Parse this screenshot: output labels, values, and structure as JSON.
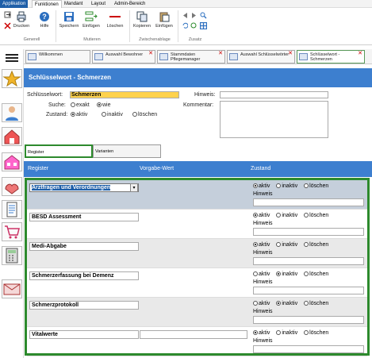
{
  "menubar": {
    "tabs": [
      "Applikation",
      "Funktionen",
      "Mandant",
      "Layout",
      "Admin-Bereich"
    ]
  },
  "ribbon": {
    "buttons": {
      "print": "Drucken",
      "help": "Hilfe",
      "save": "Speichern",
      "insert": "Einfügen",
      "delete": "Löschen",
      "copy": "Kopieren",
      "paste": "Einfügen"
    },
    "groups": {
      "general": "Generell",
      "mutate": "Mutieren",
      "clipboard": "Zwischenablage",
      "extra": "Zusatz"
    }
  },
  "doc_tabs": [
    {
      "label": "Willkommen"
    },
    {
      "label": "Auswahl Bewohner"
    },
    {
      "label": "Stammdaten Pflegemanager"
    },
    {
      "label": "Auswahl Schlüsselwörter"
    },
    {
      "label": "Schlüsselwort - Schmerzen"
    }
  ],
  "header": {
    "title": "Schlüsselwort - Schmerzen"
  },
  "form": {
    "keyword_label": "Schlüsselwort:",
    "keyword_value": "Schmerzen",
    "hint_label": "Hinweis:",
    "search_label": "Suche:",
    "search_opts": [
      "exakt",
      "wie"
    ],
    "comment_label": "Kommentar:",
    "state_label": "Zustand:",
    "state_opts": [
      "aktiv",
      "inaktiv",
      "löschen"
    ]
  },
  "subtabs": [
    "Register",
    "Varianten"
  ],
  "grid": {
    "columns": [
      "Register",
      "Vorgabe-Wert",
      "Zustand"
    ],
    "hint_label": "Hinweis",
    "state_opts": [
      "aktiv",
      "inaktiv",
      "löschen"
    ],
    "rows": [
      {
        "name": "Arztfragen und Verordnungen",
        "state": "aktiv"
      },
      {
        "name": "BESD Assessment",
        "state": "aktiv"
      },
      {
        "name": "Medi-Abgabe",
        "state": "aktiv"
      },
      {
        "name": "Schmerzerfassung bei Demenz",
        "state": "inaktiv"
      },
      {
        "name": "Schmerzprotokoll",
        "state": "inaktiv"
      },
      {
        "name": "Vitalwerte",
        "state": "aktiv"
      }
    ]
  },
  "colors": {
    "accent": "#3d7fcf",
    "highlight": "#2d8a2d",
    "keyword_bg": "#ffd24d"
  }
}
